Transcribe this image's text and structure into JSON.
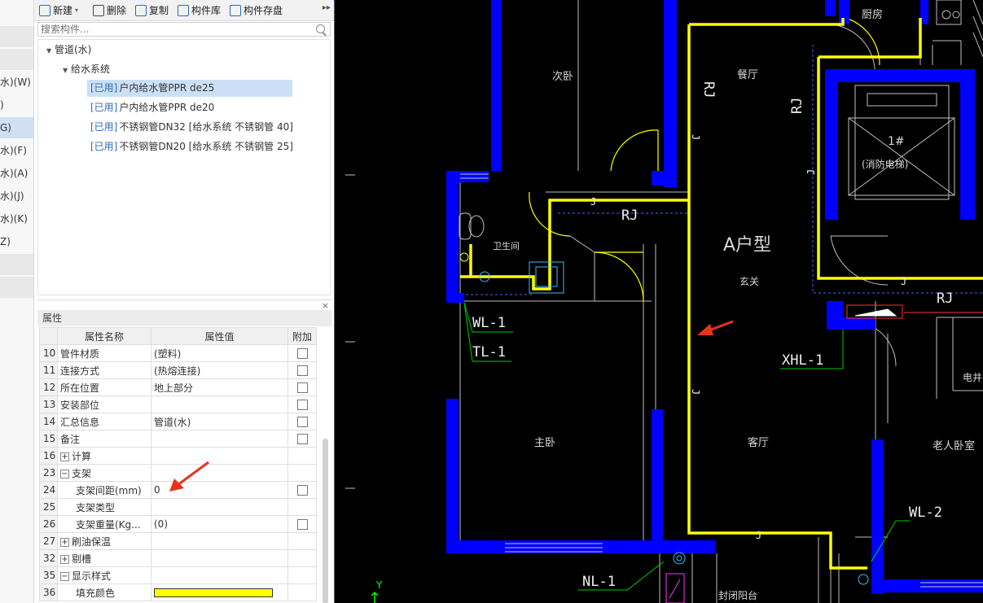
{
  "left_panel_items": [
    {
      "label": "",
      "style": "band"
    },
    {
      "label": "",
      "style": "plain"
    },
    {
      "label": "",
      "style": "band"
    },
    {
      "label": "水)(W)",
      "style": "plain"
    },
    {
      "label": ")",
      "style": "plain"
    },
    {
      "label": "G)",
      "style": "sel"
    },
    {
      "label": "水)(F)",
      "style": "plain"
    },
    {
      "label": "水)(A)",
      "style": "plain"
    },
    {
      "label": "水)(J)",
      "style": "plain"
    },
    {
      "label": "水)(K)",
      "style": "plain"
    },
    {
      "label": "Z)",
      "style": "plain"
    },
    {
      "label": "",
      "style": "band"
    },
    {
      "label": "",
      "style": "band"
    }
  ],
  "toolbar": {
    "new_label": "新建",
    "delete_label": "删除",
    "copy_label": "复制",
    "library_label": "构件库",
    "save_label": "构件存盘",
    "more_label": "▸▸"
  },
  "search": {
    "placeholder": "搜索构件..."
  },
  "tree": {
    "root": "管道(水)",
    "group": "给水系统",
    "leaves": [
      {
        "tag": "[已用]",
        "name": "户内给水管PPR de25",
        "selected": true
      },
      {
        "tag": "[已用]",
        "name": "户内给水管PPR de20",
        "selected": false
      },
      {
        "tag": "[已用]",
        "name": "不锈钢管DN32 [给水系统 不锈钢管 40]",
        "selected": false
      },
      {
        "tag": "[已用]",
        "name": "不锈钢管DN20 [给水系统 不锈钢管 25]",
        "selected": false
      }
    ]
  },
  "properties": {
    "title": "属性",
    "close": "×",
    "col_name": "属性名称",
    "col_value": "属性值",
    "col_attach": "附加",
    "rows": [
      {
        "num": "10",
        "name": "管件材质",
        "value": "(塑料)",
        "checkbox": true,
        "expander": "",
        "indent": false
      },
      {
        "num": "11",
        "name": "连接方式",
        "value": "(热熔连接)",
        "checkbox": true,
        "expander": "",
        "indent": false
      },
      {
        "num": "12",
        "name": "所在位置",
        "value": "地上部分",
        "checkbox": true,
        "expander": "",
        "indent": false
      },
      {
        "num": "13",
        "name": "安装部位",
        "value": "",
        "checkbox": true,
        "expander": "",
        "indent": false
      },
      {
        "num": "14",
        "name": "汇总信息",
        "value": "管道(水)",
        "checkbox": true,
        "expander": "",
        "indent": false
      },
      {
        "num": "15",
        "name": "备注",
        "value": "",
        "checkbox": true,
        "expander": "",
        "indent": false
      },
      {
        "num": "16",
        "name": "计算",
        "value": "",
        "checkbox": false,
        "expander": "+",
        "indent": false
      },
      {
        "num": "23",
        "name": "支架",
        "value": "",
        "checkbox": false,
        "expander": "−",
        "indent": false
      },
      {
        "num": "24",
        "name": "支架间距(mm)",
        "value": "0",
        "checkbox": true,
        "expander": "",
        "indent": true
      },
      {
        "num": "25",
        "name": "支架类型",
        "value": "",
        "checkbox": false,
        "expander": "",
        "indent": true
      },
      {
        "num": "26",
        "name": "支架重量(Kg...",
        "value": "(0)",
        "checkbox": true,
        "expander": "",
        "indent": true
      },
      {
        "num": "27",
        "name": "刷油保温",
        "value": "",
        "checkbox": false,
        "expander": "+",
        "indent": false
      },
      {
        "num": "32",
        "name": "剔槽",
        "value": "",
        "checkbox": false,
        "expander": "+",
        "indent": false
      },
      {
        "num": "35",
        "name": "显示样式",
        "value": "",
        "checkbox": false,
        "expander": "−",
        "indent": false
      },
      {
        "num": "36",
        "name": "填充颜色",
        "value": "",
        "checkbox": false,
        "expander": "",
        "indent": true,
        "swatch": "#ffff00"
      }
    ]
  },
  "cad_labels": {
    "secondary_bedroom": "次卧",
    "dining_room": "餐厅",
    "kitchen": "厨房",
    "elevator_num": "1#",
    "elevator_name": "(消防电梯)",
    "bathroom": "卫生间",
    "unit_type": "A户型",
    "foyer": "玄关",
    "living_room": "客厅",
    "master_bedroom": "主卧",
    "elderly_room": "老人卧室",
    "elec_shaft": "电井",
    "balcony": "封闭阳台",
    "wl1": "WL-1",
    "tl1": "TL-1",
    "xhl1": "XHL-1",
    "wl2": "WL-2",
    "nl1": "NL-1",
    "rj": "RJ",
    "j": "J",
    "axis_y": "Y"
  },
  "colors": {
    "wall": "#0000ff",
    "pipe": "#ffff00",
    "annotation_arrow": "#e8321e",
    "leader": "#00cc00"
  }
}
